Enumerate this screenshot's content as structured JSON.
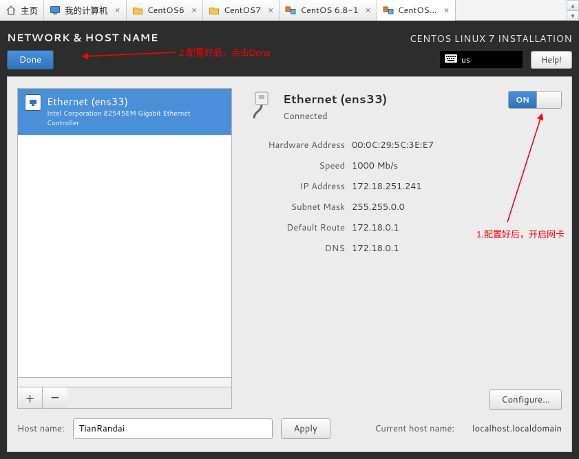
{
  "tabs": [
    {
      "label": "主页",
      "icon": "home-icon",
      "closable": false
    },
    {
      "label": "我的计算机",
      "icon": "monitor-icon",
      "closable": true
    },
    {
      "label": "CentOS6",
      "icon": "folder-icon",
      "closable": true
    },
    {
      "label": "CentOS7",
      "icon": "folder-icon",
      "closable": true
    },
    {
      "label": "CentOS 6.8-1",
      "icon": "vm-icon",
      "closable": true
    },
    {
      "label": "CentOS...",
      "icon": "vm-icon",
      "closable": true,
      "active": true
    }
  ],
  "header": {
    "title": "NETWORK & HOST NAME",
    "done_label": "Done",
    "right_title": "CENTOS LINUX 7 INSTALLATION",
    "keyboard_layout": "us",
    "help_label": "Help!"
  },
  "annotations": {
    "two": "2.配置好后，点击Done",
    "one": "1.配置好后，开启网卡"
  },
  "nic": {
    "name": "Ethernet (ens33)",
    "desc": "Intel Corporation 82545EM Gigabit Ethernet Controller"
  },
  "details": {
    "title": "Ethernet (ens33)",
    "status": "Connected",
    "toggle_on_label": "ON",
    "rows": [
      {
        "k": "Hardware Address",
        "v": "00:0C:29:5C:3E:E7"
      },
      {
        "k": "Speed",
        "v": "1000 Mb/s"
      },
      {
        "k": "IP Address",
        "v": "172.18.251.241"
      },
      {
        "k": "Subnet Mask",
        "v": "255.255.0.0"
      },
      {
        "k": "Default Route",
        "v": "172.18.0.1"
      },
      {
        "k": "DNS",
        "v": "172.18.0.1"
      }
    ],
    "configure_label": "Configure..."
  },
  "hostname": {
    "label": "Host name:",
    "value": "TianRandai",
    "apply_label": "Apply",
    "current_label": "Current host name:",
    "current_value": "localhost.localdomain"
  },
  "nic_btns": {
    "add": "+",
    "remove": "−"
  }
}
